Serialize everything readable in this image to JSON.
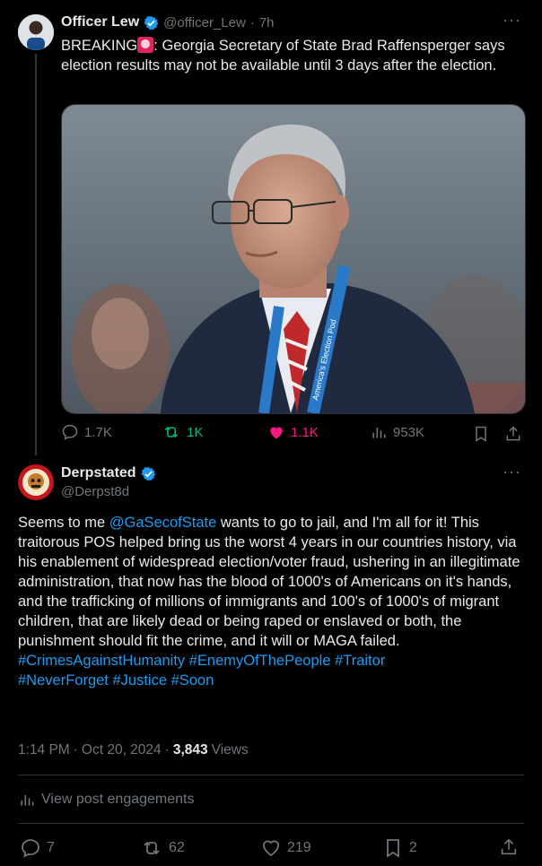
{
  "colors": {
    "accent": "#1d9bf0",
    "like": "#f91880",
    "repost": "#00ba7c",
    "muted": "#71767b"
  },
  "first_post": {
    "author_name": "Officer Lew",
    "handle": "@officer_Lew",
    "separator": "·",
    "time": "7h",
    "text_prefix": "BREAKING",
    "text_body": ": Georgia Secretary of State Brad Raffensperger says election results may not be available until 3 days after the election.",
    "lanyard_text": "America's Election Pod",
    "actions": {
      "replies": "1.7K",
      "reposts": "1K",
      "likes": "1.1K",
      "views": "953K"
    }
  },
  "main_post": {
    "author_name": "Derpstated",
    "handle": "@Derpst8d",
    "text_1": "Seems to me ",
    "mention": "@GaSecofState",
    "text_2": " wants to go to jail, and I'm all for it! This traitorous POS helped bring us the worst 4 years in our countries history, via his enablement of widespread election/voter fraud, ushering in an illegitimate administration, that now has the blood of 1000's of Americans on it's hands, and the trafficking of millions of immigrants and 100's of 1000's of migrant children, that are likely dead or being raped or enslaved or both, the punishment should fit the crime, and it will or MAGA failed.",
    "hashtags_line1": "#CrimesAgainstHumanity #EnemyOfThePeople #Traitor",
    "hashtags_line2": "#NeverForget #Justice #Soon",
    "time": "1:14 PM",
    "sep1": "·",
    "date": "Oct 20, 2024",
    "sep2": "·",
    "views_count": "3,843",
    "views_label": "Views",
    "engagements_label": "View post engagements",
    "actions": {
      "replies": "7",
      "reposts": "62",
      "likes": "219",
      "bookmarks": "2"
    }
  }
}
